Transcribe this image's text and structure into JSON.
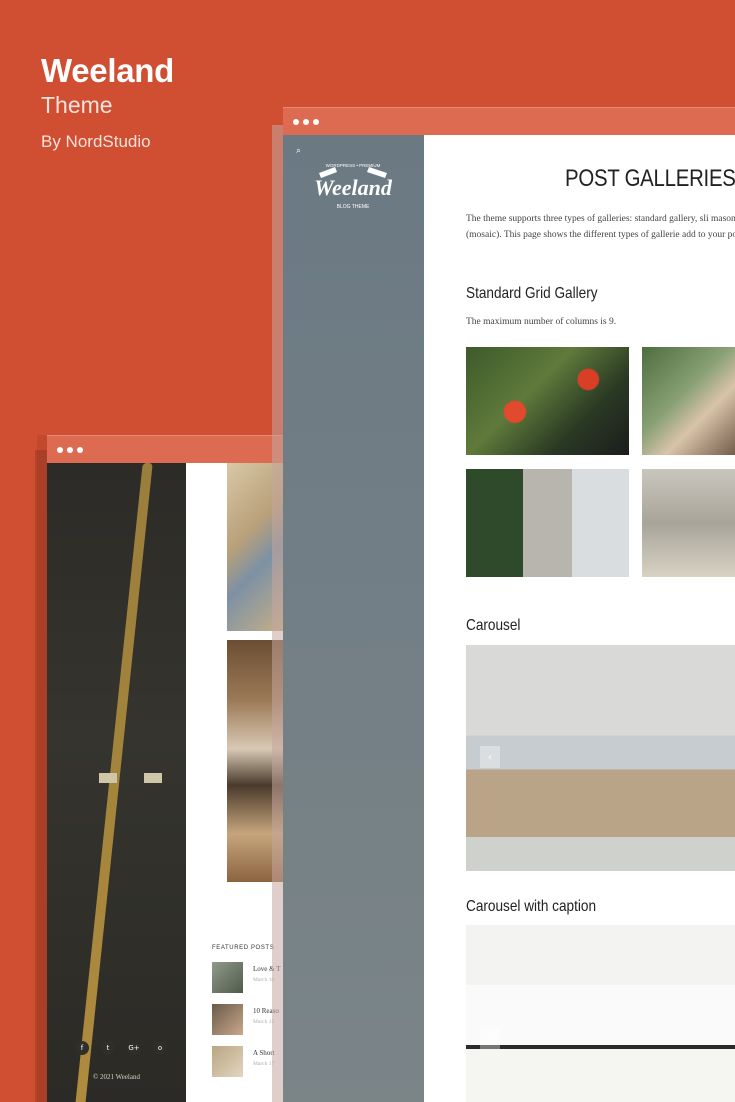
{
  "brand": {
    "title": "Weeland",
    "subtitle": "Theme",
    "byline": "By NordStudio"
  },
  "back_window": {
    "social_icons": [
      "f",
      "t",
      "G+",
      "o"
    ],
    "copyright": "© 2021 Weeland",
    "featured_heading": "FEATURED POSTS",
    "featured_posts": [
      {
        "title": "Love & T",
        "date": "March 10"
      },
      {
        "title": "10 Reaso",
        "date": "March 15"
      },
      {
        "title": "A Short",
        "date": "March 17"
      }
    ]
  },
  "front_window": {
    "logo_top": "WORDPRESS • PREMIUM",
    "logo_name": "Weeland",
    "logo_tag": "BLOG THEME",
    "page_title": "POST GALLERIES",
    "intro": "The theme supports three types of galleries: standard gallery, sli masonry (mosaic). This page shows the different types of gallerie add to your post.",
    "section1_title": "Standard Grid Gallery",
    "section1_note": "The maximum number of columns is 9.",
    "section2_title": "Carousel",
    "section3_title": "Carousel with caption"
  },
  "colors": {
    "background": "#d04e31",
    "window_bar": "#dc6b52",
    "sidebar": "#6b7983"
  }
}
